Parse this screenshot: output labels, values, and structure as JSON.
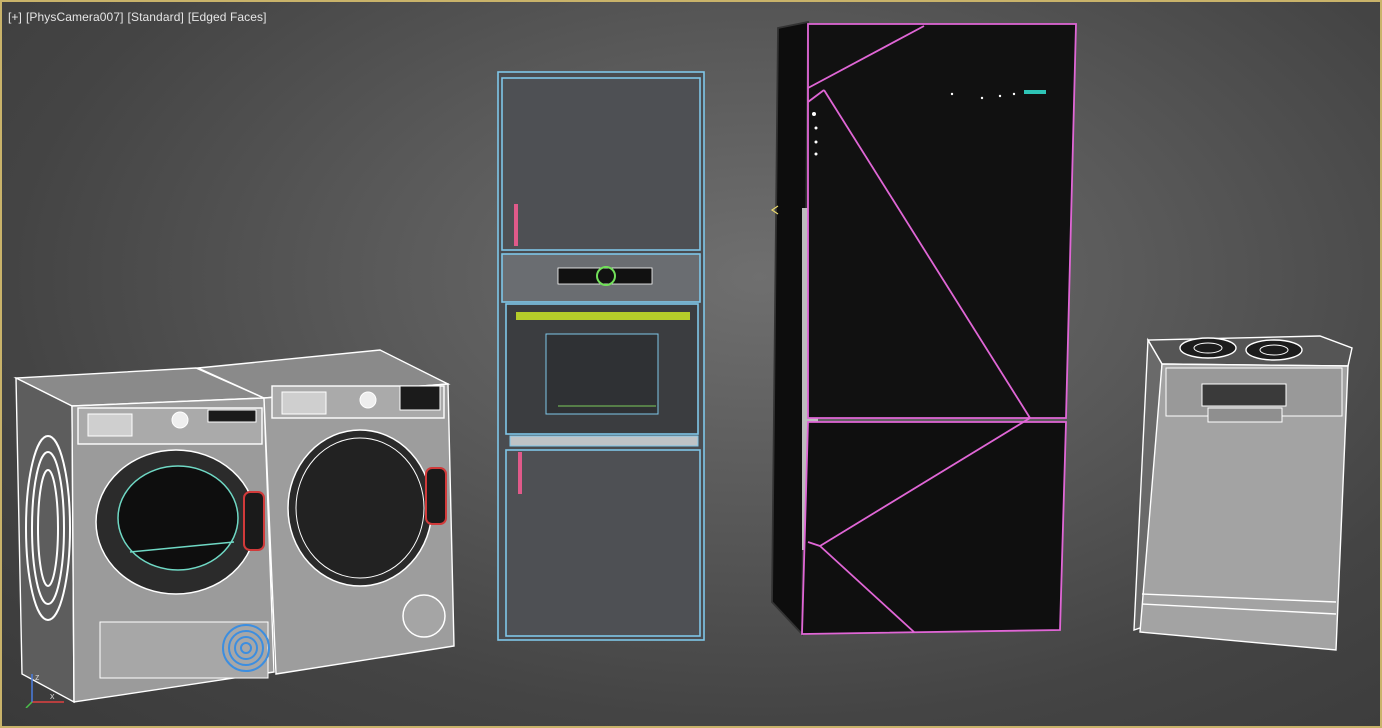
{
  "viewport": {
    "menu_plus": "[+]",
    "camera": "[PhysCamera007]",
    "shading": "[Standard]",
    "display": "[Edged Faces]"
  },
  "axis": {
    "x": "x",
    "z": "z"
  },
  "colors": {
    "border_active": "#c9b36a",
    "wire_white": "#ffffff",
    "wire_blue": "#7fc6e8",
    "wire_magenta": "#e066d6",
    "oven_green": "#b5cc2a"
  },
  "objects": [
    "washing-machine",
    "dryer",
    "tall-oven-column",
    "fridge-freezer",
    "gas-cooker"
  ]
}
